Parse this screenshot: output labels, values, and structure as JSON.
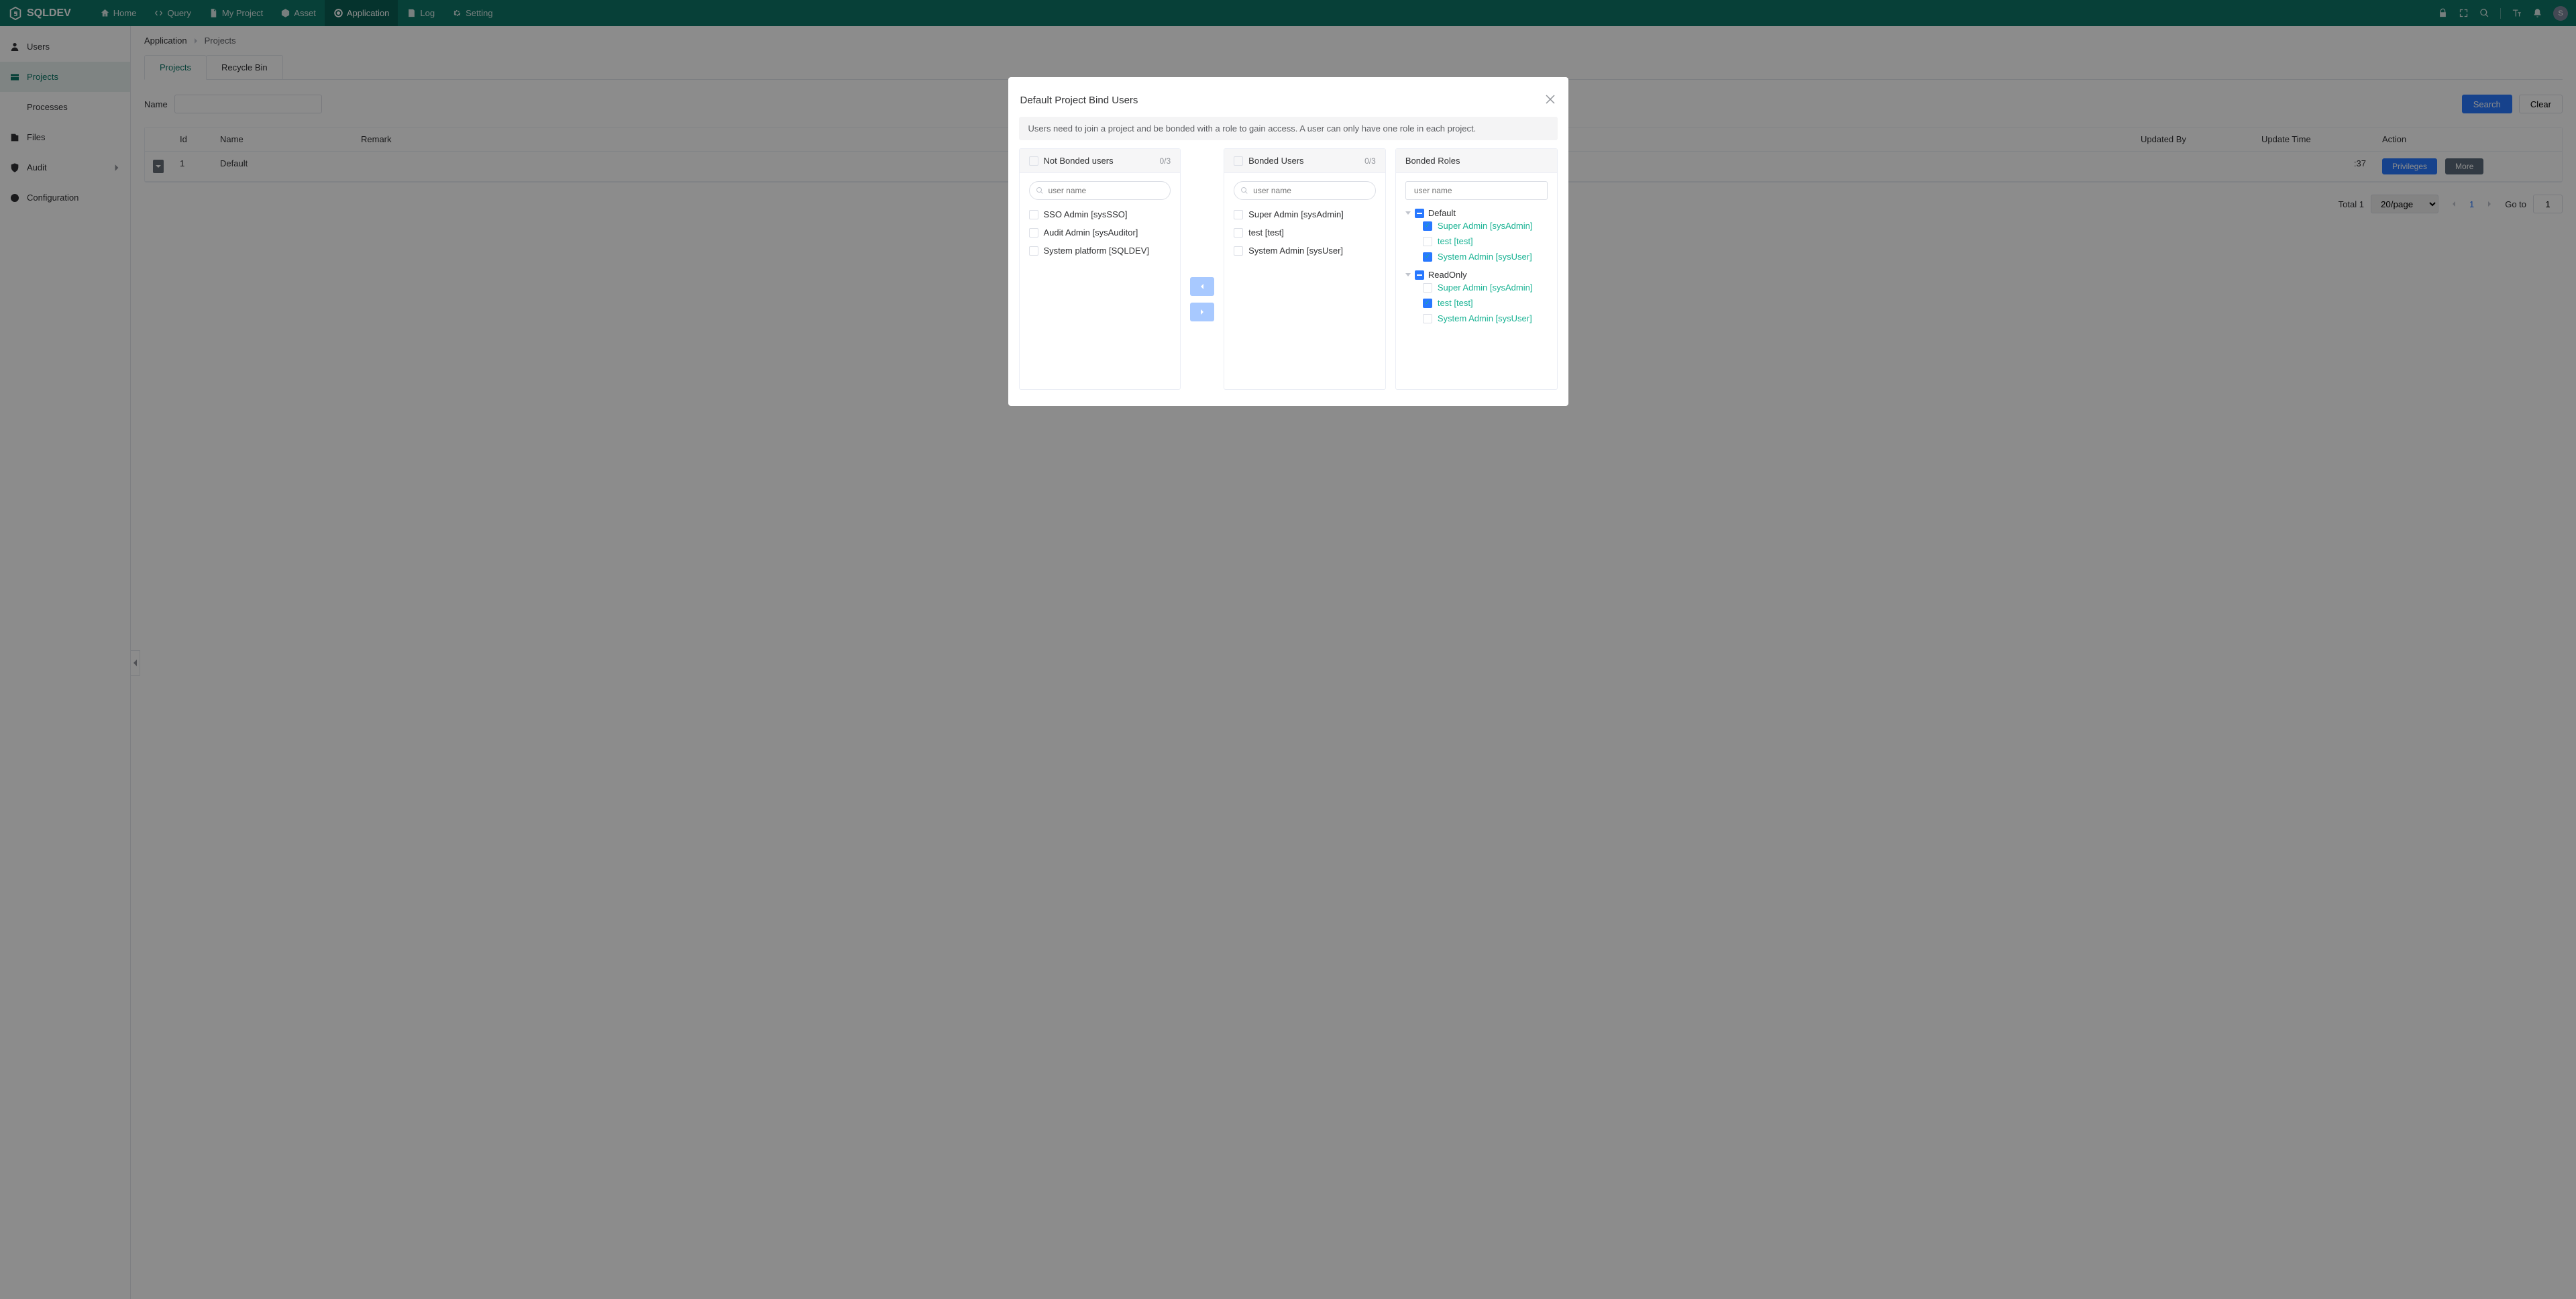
{
  "brand": "SQLDEV",
  "nav": [
    {
      "label": "Home",
      "icon": "home"
    },
    {
      "label": "Query",
      "icon": "code"
    },
    {
      "label": "My Project",
      "icon": "doc"
    },
    {
      "label": "Asset",
      "icon": "cube"
    },
    {
      "label": "Application",
      "icon": "target",
      "active": true
    },
    {
      "label": "Log",
      "icon": "log"
    },
    {
      "label": "Setting",
      "icon": "gear"
    }
  ],
  "avatar_letter": "S",
  "sidebar": [
    {
      "label": "Users",
      "icon": "user"
    },
    {
      "label": "Projects",
      "icon": "project",
      "active": true
    },
    {
      "label": "Processes",
      "icon": "process"
    },
    {
      "label": "Files",
      "icon": "files"
    },
    {
      "label": "Audit",
      "icon": "shield",
      "chev": true
    },
    {
      "label": "Configuration",
      "icon": "config"
    }
  ],
  "breadcrumb": {
    "root": "Application",
    "current": "Projects"
  },
  "tabs": [
    {
      "label": "Projects",
      "active": true
    },
    {
      "label": "Recycle Bin"
    }
  ],
  "filter": {
    "name_label": "Name",
    "search": "Search",
    "clear": "Clear"
  },
  "table": {
    "columns": [
      "Id",
      "Name",
      "Remark",
      "Updated By",
      "Update Time",
      "Action"
    ],
    "rows": [
      {
        "id": "1",
        "name": "Default",
        "remark": "",
        "updated_by": "",
        "update_time_suffix": ":37",
        "privileges": "Privileges",
        "more": "More"
      }
    ]
  },
  "pagination": {
    "total_label": "Total 1",
    "size": "20/page",
    "current": "1",
    "goto_label": "Go to",
    "goto_value": "1"
  },
  "dialog": {
    "title": "Default Project Bind Users",
    "notice": "Users need to join a project and be bonded with a role to gain access. A user can only have one role in each project.",
    "not_bonded": {
      "title": "Not Bonded users",
      "count": "0/3",
      "placeholder": "user name",
      "items": [
        "SSO Admin [sysSSO]",
        "Audit Admin [sysAuditor]",
        "System platform [SQLDEV]"
      ]
    },
    "bonded": {
      "title": "Bonded Users",
      "count": "0/3",
      "placeholder": "user name",
      "items": [
        "Super Admin [sysAdmin]",
        "test [test]",
        "System Admin [sysUser]"
      ]
    },
    "roles": {
      "title": "Bonded Roles",
      "placeholder": "user name",
      "tree": [
        {
          "name": "Default",
          "children": [
            {
              "name": "Super Admin [sysAdmin]",
              "checked": true,
              "assigned": true
            },
            {
              "name": "test [test]",
              "checked": false,
              "assigned": true
            },
            {
              "name": "System Admin [sysUser]",
              "checked": true,
              "assigned": true
            }
          ]
        },
        {
          "name": "ReadOnly",
          "children": [
            {
              "name": "Super Admin [sysAdmin]",
              "checked": false,
              "assigned": true
            },
            {
              "name": "test [test]",
              "checked": true,
              "assigned": true
            },
            {
              "name": "System Admin [sysUser]",
              "checked": false,
              "assigned": true
            }
          ]
        }
      ]
    }
  }
}
